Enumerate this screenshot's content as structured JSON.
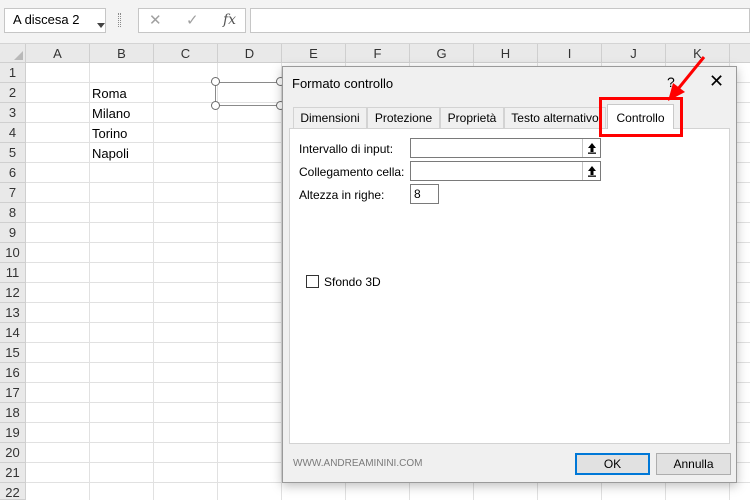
{
  "formula_bar": {
    "name_box": "A discesa 2",
    "cancel_glyph": "✕",
    "enter_glyph": "✓",
    "fx_label": "fx"
  },
  "grid": {
    "columns": [
      "A",
      "B",
      "C",
      "D",
      "E",
      "F",
      "G",
      "H",
      "I",
      "J",
      "K"
    ],
    "rows": [
      "1",
      "2",
      "3",
      "4",
      "5",
      "6",
      "7",
      "8",
      "9",
      "10",
      "11",
      "12",
      "13",
      "14",
      "15",
      "16",
      "17",
      "18",
      "19",
      "20",
      "21",
      "22"
    ],
    "cells": {
      "B2": "Roma",
      "B3": "Milano",
      "B4": "Torino",
      "B5": "Napoli"
    }
  },
  "dialog": {
    "title": "Formato controllo",
    "help": "?",
    "close": "✕",
    "tabs": [
      "Dimensioni",
      "Protezione",
      "Proprietà",
      "Testo alternativo",
      "Controllo"
    ],
    "active_tab": "Controllo",
    "fields": {
      "input_range_label": "Intervallo di input:",
      "input_range_value": "",
      "cell_link_label": "Collegamento cella:",
      "cell_link_value": "",
      "rows_label": "Altezza in righe:",
      "rows_value": "8"
    },
    "checkbox_3d_label": "Sfondo 3D",
    "checkbox_3d_checked": false,
    "watermark": "WWW.ANDREAMININI.COM",
    "ok": "OK",
    "cancel": "Annulla"
  },
  "colors": {
    "highlight": "#ff0000",
    "ok_border": "#0078d7"
  }
}
